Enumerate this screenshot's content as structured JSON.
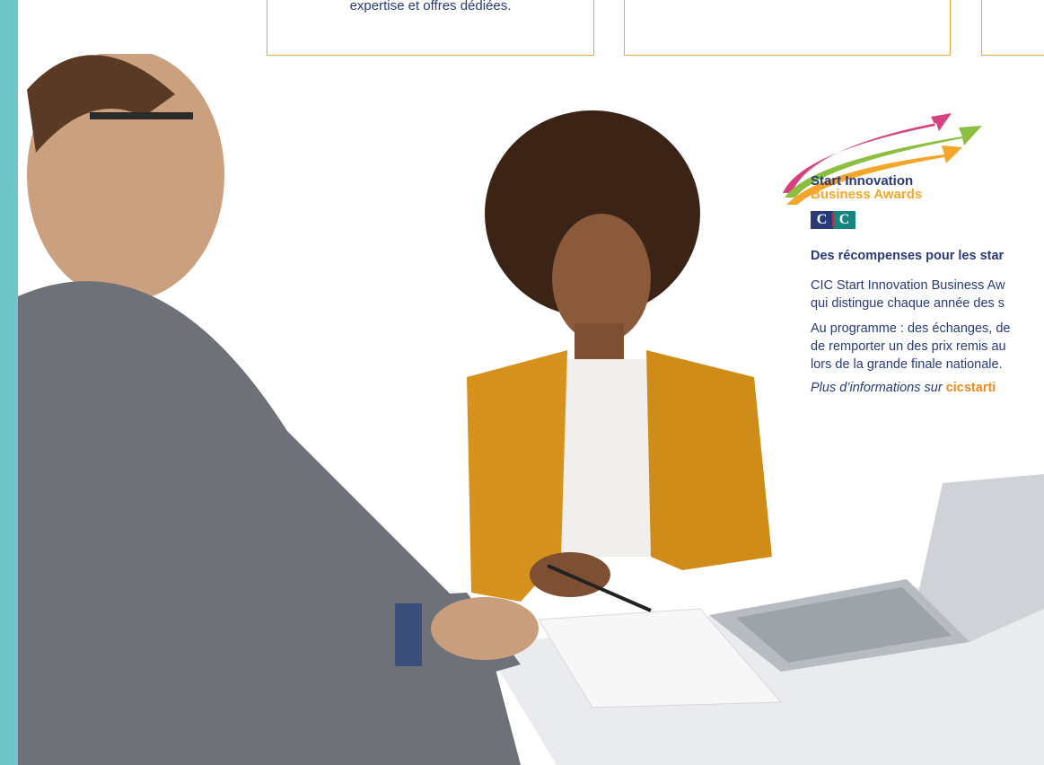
{
  "cards": [
    {
      "text": "expertise et offres dédiées."
    },
    {
      "text": ""
    },
    {
      "text": ""
    }
  ],
  "awards": {
    "logo": {
      "line1": "Start Innovation",
      "line2": "Business Awards",
      "cic_left": "C",
      "cic_right": "C"
    },
    "heading": "Des récompenses pour les star",
    "para1_line1": "CIC Start Innovation Business Aw",
    "para1_line2": "qui distingue chaque année des s",
    "para2_line1": "Au programme : des échanges, de",
    "para2_line2": "de remporter un des prix remis au",
    "para2_line3": "lors de la grande finale nationale.",
    "more_prefix": "Plus d’informations sur ",
    "more_link": "cicstarti"
  },
  "colors": {
    "accent_teal": "#6fc6c9",
    "navy": "#2a3a78",
    "orange": "#f4a62a",
    "card_border": "#f0a640",
    "arrow_pink": "#d6417f",
    "arrow_green": "#8cbf3f"
  }
}
